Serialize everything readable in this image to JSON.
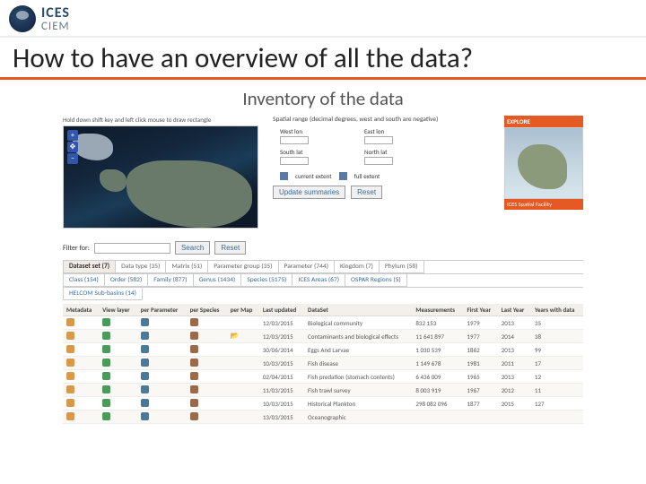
{
  "header": {
    "org1": "ICES",
    "org2": "CIEM"
  },
  "title": "How to have an overview of all the data?",
  "subtitle": "Inventory of the data",
  "map": {
    "hint": "Hold down shift key and left click mouse to draw rectangle"
  },
  "spatial": {
    "title": "Spatial range (decimal degrees, west and south are negative)",
    "fields": {
      "west": "West lon",
      "east": "East lon",
      "south": "South lat",
      "north": "North lat"
    },
    "extent": {
      "current": "current extent",
      "full": "full extent"
    },
    "update": "Update summaries",
    "reset": "Reset"
  },
  "thumb": {
    "title": "EXPLORE",
    "caption": "ICES Spatial Facility"
  },
  "filter": {
    "label": "Filter for:",
    "search": "Search",
    "reset": "Reset",
    "value": ""
  },
  "tabs_row1": [
    {
      "label": "Dataset set (7)",
      "active": true
    },
    {
      "label": "Data type (35)"
    },
    {
      "label": "Matrix (51)"
    },
    {
      "label": "Parameter group (35)"
    },
    {
      "label": "Parameter (744)"
    },
    {
      "label": "Kingdom (7)"
    },
    {
      "label": "Phylum (58)"
    }
  ],
  "tabs_row2": [
    {
      "label": "Class (154)",
      "link": true
    },
    {
      "label": "Order (582)",
      "link": true
    },
    {
      "label": "Family (877)",
      "link": true
    },
    {
      "label": "Genus (1434)",
      "link": true
    },
    {
      "label": "Species (5175)",
      "link": true
    },
    {
      "label": "ICES Areas (67)",
      "link": true
    },
    {
      "label": "OSPAR Regions (5)",
      "link": true
    }
  ],
  "tabs_row3": [
    {
      "label": "HELCOM Sub-basins (14)",
      "link": true
    }
  ],
  "cols": {
    "metadata": "Metadata",
    "viewlayer": "View layer",
    "perparam": "per Parameter",
    "perspecies": "per Species",
    "permap": "per Map",
    "lastupdated": "Last updated",
    "dataset": "DataSet",
    "measurements": "Measurements",
    "firstyear": "First Year",
    "lastyear": "Last Year",
    "yearswith": "Years with data"
  },
  "rows": [
    {
      "lu": "12/03/2015",
      "ds": "Biological community",
      "m": "832 153",
      "fy": "1979",
      "ly": "2013",
      "yw": "35"
    },
    {
      "lu": "12/03/2015",
      "ds": "Contaminants and biological effects",
      "m": "11 641 897",
      "fy": "1977",
      "ly": "2014",
      "yw": "38",
      "open": true
    },
    {
      "lu": "30/06/2014",
      "ds": "Eggs And Larvae",
      "m": "1 030 539",
      "fy": "1862",
      "ly": "2013",
      "yw": "99"
    },
    {
      "lu": "10/03/2015",
      "ds": "Fish disease",
      "m": "1 149 678",
      "fy": "1981",
      "ly": "2011",
      "yw": "17"
    },
    {
      "lu": "02/04/2015",
      "ds": "Fish predation (stomach contents)",
      "m": "6 436 009",
      "fy": "1965",
      "ly": "2013",
      "yw": "12"
    },
    {
      "lu": "11/03/2015",
      "ds": "Fish trawl survey",
      "m": "8 003 919",
      "fy": "1967",
      "ly": "2012",
      "yw": "11"
    },
    {
      "lu": "10/03/2015",
      "ds": "Historical Plankton",
      "m": "298 082 096",
      "fy": "1877",
      "ly": "2015",
      "yw": "127"
    },
    {
      "lu": "13/03/2015",
      "ds": "Oceanographic",
      "m": "",
      "fy": "",
      "ly": "",
      "yw": ""
    }
  ]
}
